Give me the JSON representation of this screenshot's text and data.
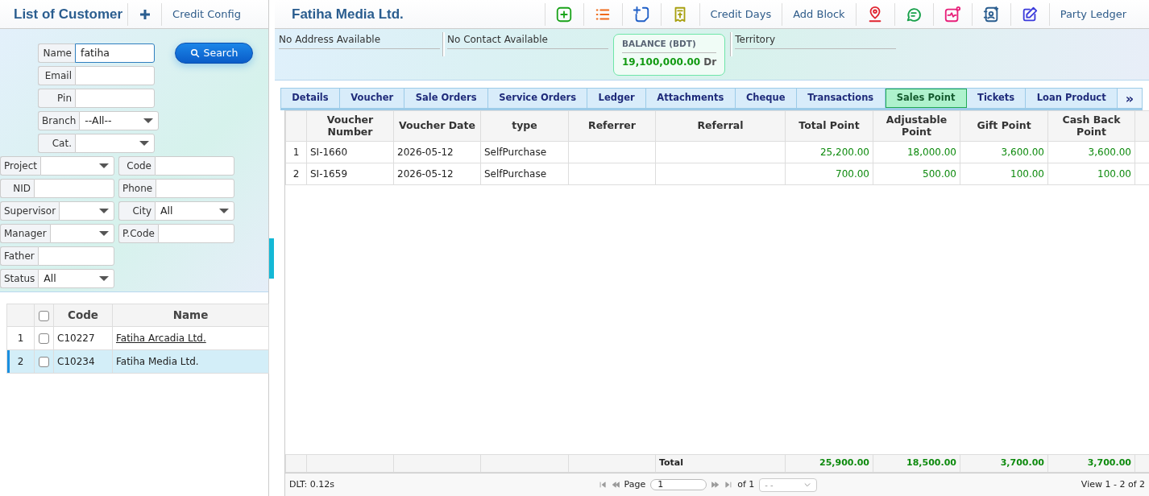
{
  "left": {
    "title": "List of Customer",
    "buttons": [
      {
        "kind": "icon"
      },
      {
        "kind": "text",
        "label": "Credit Config"
      }
    ]
  },
  "filters": {
    "top": [
      {
        "label": "Name",
        "kind": "text",
        "value": "fatiha"
      },
      {
        "label": "Email",
        "kind": "text"
      },
      {
        "label": "Pin",
        "kind": "text"
      },
      {
        "label": "Branch",
        "kind": "select",
        "value": "--All--"
      },
      {
        "label": "Cat.",
        "kind": "select"
      }
    ],
    "search": "Search",
    "pairs": [
      [
        {
          "label": "Project",
          "kind": "select"
        },
        {
          "label": "Code",
          "kind": "text"
        }
      ],
      [
        {
          "label": "NID",
          "kind": "text"
        },
        {
          "label": "Phone",
          "kind": "text"
        }
      ],
      [
        {
          "label": "Supervisor",
          "kind": "select"
        },
        {
          "label": "City",
          "kind": "select",
          "value": "All"
        }
      ],
      [
        {
          "label": "Manager",
          "kind": "select"
        },
        {
          "label": "P.Code",
          "kind": "text"
        }
      ],
      [
        {
          "label": "Father",
          "kind": "text"
        }
      ],
      [
        {
          "label": "Status",
          "kind": "select",
          "value": "All"
        }
      ]
    ]
  },
  "customers": {
    "columns": [
      "Code",
      "Name"
    ],
    "header_checked": false,
    "rows": [
      {
        "num": "1",
        "code": "C10227",
        "name": "Fatiha Arcadia Ltd.",
        "checked": false,
        "selected": false,
        "linked": true
      },
      {
        "num": "2",
        "code": "C10234",
        "name": "Fatiha Media Ltd.",
        "checked": false,
        "selected": true,
        "linked": false
      }
    ]
  },
  "party": {
    "title": "Fatiha Media Ltd.",
    "toolbar": [
      {
        "kind": "icon"
      },
      {
        "kind": "icon"
      },
      {
        "kind": "icon"
      },
      {
        "kind": "icon"
      },
      {
        "kind": "text",
        "label": "Credit Days"
      },
      {
        "kind": "text",
        "label": "Add Block"
      },
      {
        "kind": "icon"
      },
      {
        "kind": "icon"
      },
      {
        "kind": "icon"
      },
      {
        "kind": "icon"
      },
      {
        "kind": "icon"
      },
      {
        "kind": "text",
        "label": "Party Ledger"
      }
    ],
    "address": "No Address Available",
    "contact": "No Contact Available",
    "balance": {
      "label": "BALANCE (BDT)",
      "amount": "19,100,000.00",
      "side": "Dr"
    },
    "territory": "Territory"
  },
  "tabs": [
    {
      "label": "Details",
      "selected": false
    },
    {
      "label": "Voucher",
      "selected": false
    },
    {
      "label": "Sale Orders",
      "selected": false
    },
    {
      "label": "Service Orders",
      "selected": false
    },
    {
      "label": "Ledger",
      "selected": false
    },
    {
      "label": "Attachments",
      "selected": false
    },
    {
      "label": "Cheque",
      "selected": false
    },
    {
      "label": "Transactions",
      "selected": false
    },
    {
      "label": "Sales Point",
      "selected": true
    },
    {
      "label": "Tickets",
      "selected": false
    },
    {
      "label": "Loan Product",
      "selected": false
    }
  ],
  "tabs_more": "»",
  "table": {
    "columns": [
      "Voucher Number",
      "Voucher Date",
      "type",
      "Referrer",
      "Referral",
      "Total Point",
      "Adjustable Point",
      "Gift Point",
      "Cash Back Point"
    ],
    "rows": [
      {
        "num": "1",
        "cells": [
          "SI-1660",
          "2026-05-12",
          "SelfPurchase",
          "",
          "",
          "25,200.00",
          "18,000.00",
          "3,600.00",
          "3,600.00"
        ]
      },
      {
        "num": "2",
        "cells": [
          "SI-1659",
          "2026-05-12",
          "SelfPurchase",
          "",
          "",
          "700.00",
          "500.00",
          "100.00",
          "100.00"
        ]
      }
    ],
    "total_label": "Total",
    "totals": [
      "25,900.00",
      "18,500.00",
      "3,700.00",
      "3,700.00"
    ]
  },
  "pager": {
    "dlt": "DLT: 0.12s",
    "page_label": "Page",
    "page": "1",
    "of": "of 1",
    "size": "- -",
    "view": "View 1 - 2 of 2"
  }
}
